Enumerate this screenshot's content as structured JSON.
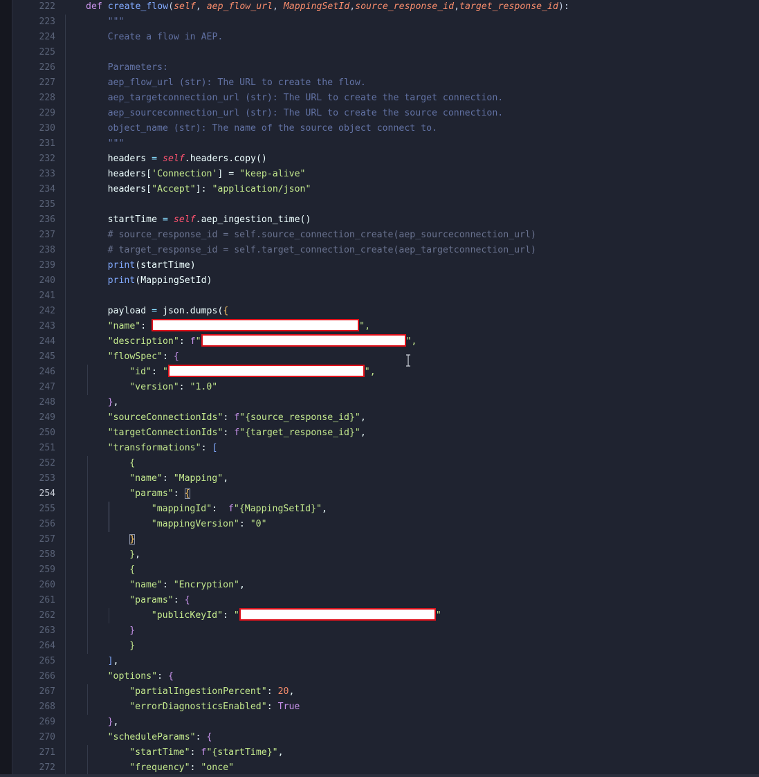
{
  "editor": {
    "active_line": 254,
    "lines": [
      {
        "n": "222",
        "tokens": [
          [
            "def",
            "k-def"
          ],
          [
            " ",
            "k-var"
          ],
          [
            "create_flow",
            "k-fn"
          ],
          [
            "(",
            "k-punc"
          ],
          [
            "self",
            "k-param"
          ],
          [
            ", ",
            "k-punc"
          ],
          [
            "aep_flow_url",
            "k-param"
          ],
          [
            ", ",
            "k-punc"
          ],
          [
            "MappingSetId",
            "k-param"
          ],
          [
            ",",
            "k-punc"
          ],
          [
            "source_response_id",
            "k-param"
          ],
          [
            ",",
            "k-punc"
          ],
          [
            "target_response_id",
            "k-param"
          ],
          [
            "):",
            "k-punc"
          ]
        ]
      },
      {
        "n": "223",
        "tokens": [
          [
            "\"\"\"",
            "k-doc"
          ]
        ]
      },
      {
        "n": "224",
        "tokens": [
          [
            "Create a flow in AEP.",
            "k-doc"
          ]
        ]
      },
      {
        "n": "225",
        "tokens": []
      },
      {
        "n": "226",
        "tokens": [
          [
            "Parameters:",
            "k-doc"
          ]
        ]
      },
      {
        "n": "227",
        "tokens": [
          [
            "aep_flow_url (str): The URL to create the flow.",
            "k-doc"
          ]
        ]
      },
      {
        "n": "228",
        "tokens": [
          [
            "aep_targetconnection_url (str): The URL to create the target connection.",
            "k-doc"
          ]
        ]
      },
      {
        "n": "229",
        "tokens": [
          [
            "aep_sourceconnection_url (str): The URL to create the source connection.",
            "k-doc"
          ]
        ]
      },
      {
        "n": "230",
        "tokens": [
          [
            "object_name (str): The name of the source object connect to.",
            "k-doc"
          ]
        ]
      },
      {
        "n": "231",
        "tokens": [
          [
            "\"\"\"",
            "k-doc"
          ]
        ]
      },
      {
        "n": "232",
        "tokens": [
          [
            "headers",
            "k-var"
          ],
          [
            " = ",
            "k-op"
          ],
          [
            "self",
            "k-self"
          ],
          [
            ".headers.copy()",
            "k-var"
          ]
        ]
      },
      {
        "n": "233",
        "tokens": [
          [
            "headers[",
            "k-var"
          ],
          [
            "'Connection'",
            "k-str"
          ],
          [
            "] = ",
            "k-var"
          ],
          [
            "\"keep-alive\"",
            "k-str"
          ]
        ]
      },
      {
        "n": "234",
        "tokens": [
          [
            "headers[",
            "k-var"
          ],
          [
            "\"Accept\"",
            "k-str"
          ],
          [
            "]: ",
            "k-var"
          ],
          [
            "\"application/json\"",
            "k-str"
          ]
        ]
      },
      {
        "n": "235",
        "tokens": []
      },
      {
        "n": "236",
        "tokens": [
          [
            "startTime",
            "k-var"
          ],
          [
            " = ",
            "k-op"
          ],
          [
            "self",
            "k-self"
          ],
          [
            ".aep_ingestion_time()",
            "k-var"
          ]
        ]
      },
      {
        "n": "237",
        "tokens": [
          [
            "# source_response_id = self.source_connection_create(aep_sourceconnection_url)",
            "k-comment"
          ]
        ]
      },
      {
        "n": "238",
        "tokens": [
          [
            "# target_response_id = self.target_connection_create(aep_targetconnection_url)",
            "k-comment"
          ]
        ]
      },
      {
        "n": "239",
        "tokens": [
          [
            "print",
            "k-builtin"
          ],
          [
            "(startTime)",
            "k-var"
          ]
        ]
      },
      {
        "n": "240",
        "tokens": [
          [
            "print",
            "k-builtin"
          ],
          [
            "(MappingSetId)",
            "k-var"
          ]
        ]
      },
      {
        "n": "241",
        "tokens": []
      },
      {
        "n": "242",
        "tokens": [
          [
            "payload",
            "k-var"
          ],
          [
            " = ",
            "k-op"
          ],
          [
            "json.dumps(",
            "k-var"
          ],
          [
            "{",
            "k-brace-y"
          ]
        ]
      },
      {
        "n": "243",
        "tokens": [
          [
            "\"name\"",
            "k-str"
          ],
          [
            ": ",
            "k-var"
          ],
          [
            "REDACT:300",
            "redact"
          ],
          [
            "\",",
            "k-str"
          ]
        ]
      },
      {
        "n": "244",
        "tokens": [
          [
            "\"description\"",
            "k-str"
          ],
          [
            ": ",
            "k-var"
          ],
          [
            "f",
            "k-fprefix"
          ],
          [
            "\"",
            "k-str"
          ],
          [
            "REDACT:296",
            "redact"
          ],
          [
            "\",",
            "k-str"
          ]
        ]
      },
      {
        "n": "245",
        "tokens": [
          [
            "\"flowSpec\"",
            "k-str"
          ],
          [
            ": ",
            "k-var"
          ],
          [
            "{",
            "k-brace-p"
          ]
        ]
      },
      {
        "n": "246",
        "tokens": [
          [
            "\"id\"",
            "k-str"
          ],
          [
            ": ",
            "k-var"
          ],
          [
            "\"",
            "k-str"
          ],
          [
            "REDACT:284",
            "redact"
          ],
          [
            "\",",
            "k-str"
          ]
        ]
      },
      {
        "n": "247",
        "tokens": [
          [
            "\"version\"",
            "k-str"
          ],
          [
            ": ",
            "k-var"
          ],
          [
            "\"1.0\"",
            "k-str"
          ]
        ]
      },
      {
        "n": "248",
        "tokens": [
          [
            "}",
            "k-brace-p"
          ],
          [
            ",",
            "k-var"
          ]
        ]
      },
      {
        "n": "249",
        "tokens": [
          [
            "\"sourceConnectionIds\"",
            "k-str"
          ],
          [
            ": ",
            "k-var"
          ],
          [
            "f",
            "k-fprefix"
          ],
          [
            "\"{source_response_id}\"",
            "k-str"
          ],
          [
            ",",
            "k-var"
          ]
        ]
      },
      {
        "n": "250",
        "tokens": [
          [
            "\"targetConnectionIds\"",
            "k-str"
          ],
          [
            ": ",
            "k-var"
          ],
          [
            "f",
            "k-fprefix"
          ],
          [
            "\"{target_response_id}\"",
            "k-str"
          ],
          [
            ",",
            "k-var"
          ]
        ]
      },
      {
        "n": "251",
        "tokens": [
          [
            "\"transformations\"",
            "k-str"
          ],
          [
            ": ",
            "k-var"
          ],
          [
            "[",
            "k-brace-b"
          ]
        ]
      },
      {
        "n": "252",
        "tokens": [
          [
            "{",
            "k-brace-g"
          ]
        ]
      },
      {
        "n": "253",
        "tokens": [
          [
            "\"name\"",
            "k-str"
          ],
          [
            ": ",
            "k-var"
          ],
          [
            "\"Mapping\"",
            "k-str"
          ],
          [
            ",",
            "k-var"
          ]
        ]
      },
      {
        "n": "254",
        "tokens": [
          [
            "\"params\"",
            "k-str"
          ],
          [
            ": ",
            "k-var"
          ],
          [
            "{",
            "k-brace-y box"
          ]
        ]
      },
      {
        "n": "255",
        "tokens": [
          [
            "\"mappingId\"",
            "k-str"
          ],
          [
            ":  ",
            "k-var"
          ],
          [
            "f",
            "k-fprefix"
          ],
          [
            "\"{MappingSetId}\"",
            "k-str"
          ],
          [
            ",",
            "k-var"
          ]
        ]
      },
      {
        "n": "256",
        "tokens": [
          [
            "\"mappingVersion\"",
            "k-str"
          ],
          [
            ": ",
            "k-var"
          ],
          [
            "\"0\"",
            "k-str"
          ]
        ]
      },
      {
        "n": "257",
        "tokens": [
          [
            "}",
            "k-brace-y box"
          ]
        ]
      },
      {
        "n": "258",
        "tokens": [
          [
            "}",
            "k-brace-g"
          ],
          [
            ",",
            "k-var"
          ]
        ]
      },
      {
        "n": "259",
        "tokens": [
          [
            "{",
            "k-brace-g"
          ]
        ]
      },
      {
        "n": "260",
        "tokens": [
          [
            "\"name\"",
            "k-str"
          ],
          [
            ": ",
            "k-var"
          ],
          [
            "\"Encryption\"",
            "k-str"
          ],
          [
            ",",
            "k-var"
          ]
        ]
      },
      {
        "n": "261",
        "tokens": [
          [
            "\"params\"",
            "k-str"
          ],
          [
            ": ",
            "k-var"
          ],
          [
            "{",
            "k-brace-p"
          ]
        ]
      },
      {
        "n": "262",
        "tokens": [
          [
            "\"publicKeyId\"",
            "k-str"
          ],
          [
            ": ",
            "k-var"
          ],
          [
            "\"",
            "k-str"
          ],
          [
            "REDACT:284",
            "redact"
          ],
          [
            "\"",
            "k-str"
          ]
        ]
      },
      {
        "n": "263",
        "tokens": [
          [
            "}",
            "k-brace-p"
          ]
        ]
      },
      {
        "n": "264",
        "tokens": [
          [
            "}",
            "k-brace-g"
          ]
        ]
      },
      {
        "n": "265",
        "tokens": [
          [
            "]",
            "k-brace-b"
          ],
          [
            ",",
            "k-var"
          ]
        ]
      },
      {
        "n": "266",
        "tokens": [
          [
            "\"options\"",
            "k-str"
          ],
          [
            ": ",
            "k-var"
          ],
          [
            "{",
            "k-brace-p"
          ]
        ]
      },
      {
        "n": "267",
        "tokens": [
          [
            "\"partialIngestionPercent\"",
            "k-str"
          ],
          [
            ": ",
            "k-var"
          ],
          [
            "20",
            "k-num"
          ],
          [
            ",",
            "k-var"
          ]
        ]
      },
      {
        "n": "268",
        "tokens": [
          [
            "\"errorDiagnosticsEnabled\"",
            "k-str"
          ],
          [
            ": ",
            "k-var"
          ],
          [
            "True",
            "k-true"
          ]
        ]
      },
      {
        "n": "269",
        "tokens": [
          [
            "}",
            "k-brace-p"
          ],
          [
            ",",
            "k-var"
          ]
        ]
      },
      {
        "n": "270",
        "tokens": [
          [
            "\"scheduleParams\"",
            "k-str"
          ],
          [
            ": ",
            "k-var"
          ],
          [
            "{",
            "k-brace-p"
          ]
        ]
      },
      {
        "n": "271",
        "tokens": [
          [
            "\"startTime\"",
            "k-str"
          ],
          [
            ": ",
            "k-var"
          ],
          [
            "f",
            "k-fprefix"
          ],
          [
            "\"{startTime}\"",
            "k-str"
          ],
          [
            ",",
            "k-var"
          ]
        ]
      },
      {
        "n": "272",
        "tokens": [
          [
            "\"frequency\"",
            "k-str"
          ],
          [
            ": ",
            "k-var"
          ],
          [
            "\"once\"",
            "k-str"
          ]
        ]
      }
    ]
  }
}
